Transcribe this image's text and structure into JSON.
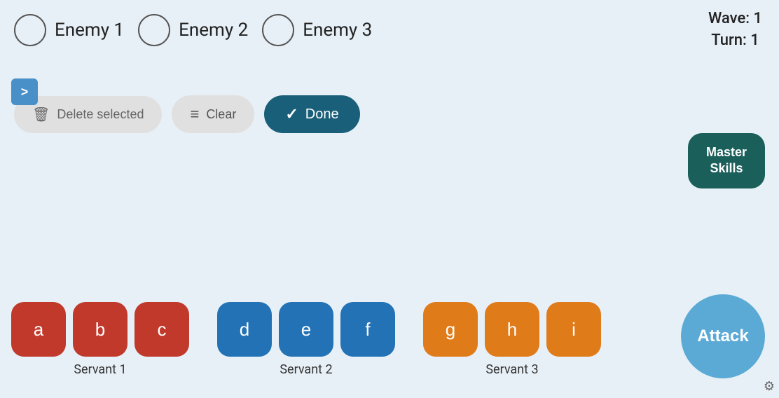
{
  "enemies": [
    {
      "id": "enemy-1",
      "label": "Enemy 1"
    },
    {
      "id": "enemy-2",
      "label": "Enemy 2"
    },
    {
      "id": "enemy-3",
      "label": "Enemy 3"
    }
  ],
  "wave": {
    "wave_label": "Wave: 1",
    "turn_label": "Turn: 1"
  },
  "actions": {
    "delete_label": "Delete selected",
    "clear_label": "Clear",
    "done_label": "Done",
    "master_skills_label": "Master\nSkills",
    "attack_label": "Attack"
  },
  "servants": [
    {
      "id": "servant-1",
      "name": "Servant 1",
      "color": "red",
      "cards": [
        {
          "id": "card-a",
          "label": "a"
        },
        {
          "id": "card-b",
          "label": "b"
        },
        {
          "id": "card-c",
          "label": "c"
        }
      ]
    },
    {
      "id": "servant-2",
      "name": "Servant 2",
      "color": "blue",
      "cards": [
        {
          "id": "card-d",
          "label": "d"
        },
        {
          "id": "card-e",
          "label": "e"
        },
        {
          "id": "card-f",
          "label": "f"
        }
      ]
    },
    {
      "id": "servant-3",
      "name": "Servant 3",
      "color": "orange",
      "cards": [
        {
          "id": "card-g",
          "label": "g"
        },
        {
          "id": "card-h",
          "label": "h"
        },
        {
          "id": "card-i",
          "label": "i"
        }
      ]
    }
  ],
  "chevron": {
    "label": ">"
  },
  "settings_icon": "⚙"
}
